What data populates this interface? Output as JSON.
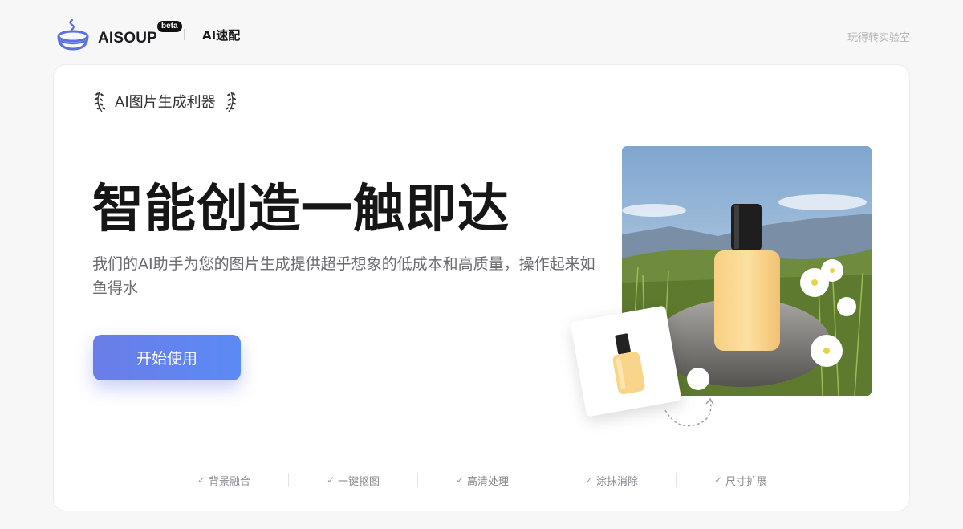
{
  "header": {
    "logo_text": "AISOUP",
    "beta_badge": "beta",
    "product_name": "AI速配",
    "lab_link": "玩得转实验室",
    "logo_icon": "soup-bowl-icon"
  },
  "hero": {
    "tagline": "AI图片生成利器",
    "title": "智能创造一触即达",
    "description": "我们的AI助手为您的图片生成提供超乎想象的低成本和高质量，操作起来如鱼得水",
    "cta_label": "开始使用"
  },
  "features": [
    {
      "label": "背景融合",
      "icon": "check-icon"
    },
    {
      "label": "一键抠图",
      "icon": "check-icon"
    },
    {
      "label": "高清处理",
      "icon": "check-icon"
    },
    {
      "label": "涂抹消除",
      "icon": "check-icon"
    },
    {
      "label": "尺寸扩展",
      "icon": "check-icon"
    }
  ],
  "colors": {
    "accent_start": "#6a7de8",
    "accent_end": "#5b8af5",
    "page_bg": "#f7f7f8",
    "card_bg": "#ffffff"
  }
}
